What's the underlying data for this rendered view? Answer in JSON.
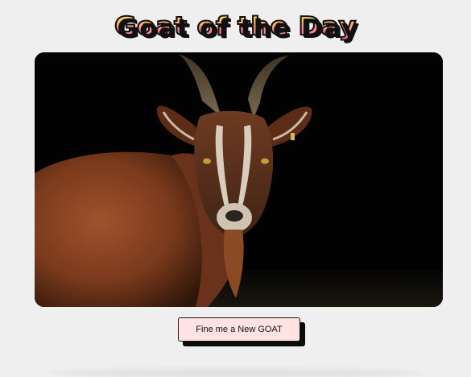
{
  "page": {
    "title": "Goat of the Day"
  },
  "photo": {
    "subject": "brown goat with curved horns on black background"
  },
  "actions": {
    "new_goat_label": "Fine me a New GOAT"
  },
  "colors": {
    "page_background": "#efefef",
    "button_background": "#ffe3e3",
    "button_shadow": "#0b0b0b",
    "title_gradient": [
      "#fff27a",
      "#ffc25a",
      "#ff8a8a",
      "#ff5fb4"
    ]
  }
}
